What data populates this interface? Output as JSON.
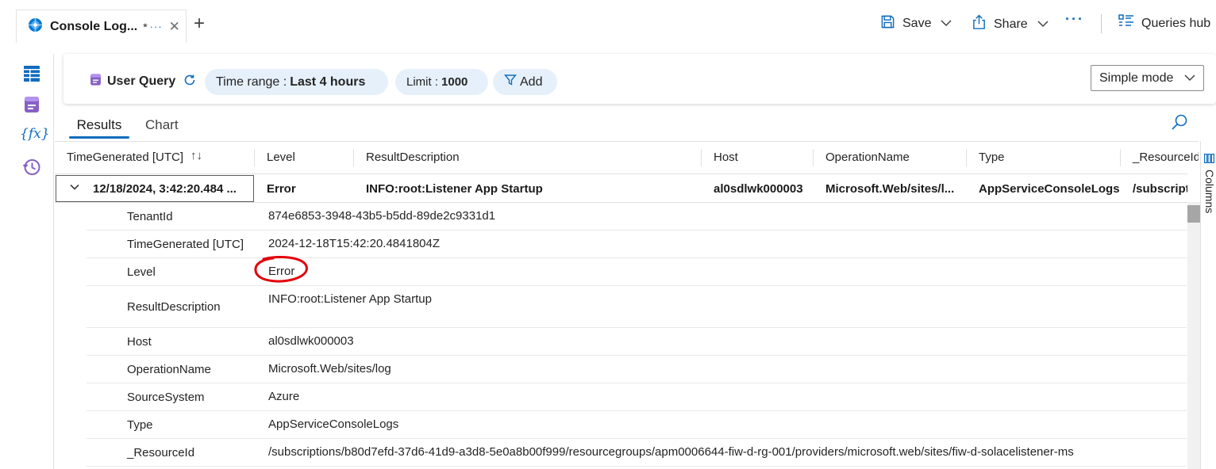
{
  "tab": {
    "title": "Console Log...",
    "modified": "*",
    "more": "···",
    "close": "✕",
    "new_tab": "+"
  },
  "toolbar": {
    "save": "Save",
    "share": "Share",
    "more": "···",
    "queries_hub": "Queries hub"
  },
  "query": {
    "name": "User Query",
    "time_range_label": "Time range :",
    "time_range_value": "Last 4 hours",
    "limit_label": "Limit :",
    "limit_value": "1000",
    "add_label": "Add",
    "mode": "Simple mode"
  },
  "result_tabs": {
    "results": "Results",
    "chart": "Chart"
  },
  "columns": {
    "headers": [
      "TimeGenerated [UTC]",
      "Level",
      "ResultDescription",
      "Host",
      "OperationName",
      "Type",
      "_ResourceId"
    ],
    "sort_icon": "↑↓",
    "side_label": "Columns"
  },
  "row": {
    "time": "12/18/2024, 3:42:20.484 ...",
    "level": "Error",
    "description": "INFO:root:Listener App Startup",
    "host": "al0sdlwk000003",
    "operation": "Microsoft.Web/sites/l...",
    "type": "AppServiceConsoleLogs",
    "resource": "/subscript"
  },
  "details": [
    {
      "key": "TenantId",
      "value": "874e6853-3948-43b5-b5dd-89de2c9331d1"
    },
    {
      "key": "TimeGenerated [UTC]",
      "value": "2024-12-18T15:42:20.4841804Z"
    },
    {
      "key": "Level",
      "value": "Error"
    },
    {
      "key": "ResultDescription",
      "value": "INFO:root:Listener App Startup"
    },
    {
      "key": "Host",
      "value": "al0sdlwk000003"
    },
    {
      "key": "OperationName",
      "value": "Microsoft.Web/sites/log"
    },
    {
      "key": "SourceSystem",
      "value": "Azure"
    },
    {
      "key": "Type",
      "value": "AppServiceConsoleLogs"
    },
    {
      "key": "_ResourceId",
      "value": "/subscriptions/b80d7efd-37d6-41d9-a3d8-5e0a8b00f999/resourcegroups/apm0006644-fiw-d-rg-001/providers/microsoft.web/sites/fiw-d-solacelistener-ms"
    }
  ],
  "colors": {
    "accent": "#0f6cbd",
    "pill_bg": "#e6f0fb",
    "annotation_red": "#e3000b"
  }
}
